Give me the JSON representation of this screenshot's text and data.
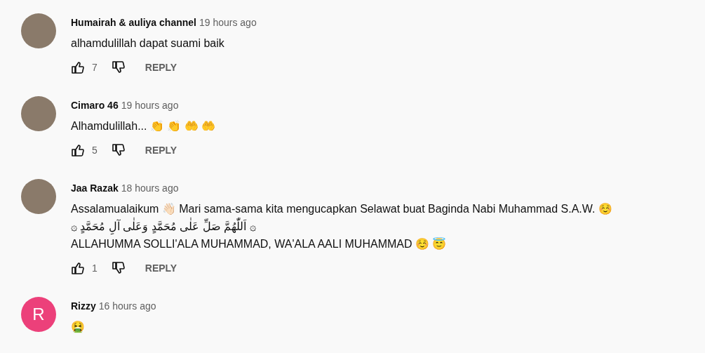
{
  "comments": [
    {
      "author": "Humairah & auliya channel",
      "time": "19 hours ago",
      "avatar": {
        "kind": "photo"
      },
      "lines": [
        "alhamdulillah dapat suami baik"
      ],
      "likes": "7",
      "reply": "REPLY"
    },
    {
      "author": "Cimaro 46",
      "time": "19 hours ago",
      "avatar": {
        "kind": "photo"
      },
      "lines": [
        "Alhamdulillah... 👏 👏 🤲 🤲"
      ],
      "likes": "5",
      "reply": "REPLY"
    },
    {
      "author": "Jaa Razak",
      "time": "18 hours ago",
      "avatar": {
        "kind": "photo"
      },
      "lines": [
        "Assalamualaikum 👋🏻  Mari sama-sama kita mengucapkan Selawat buat Baginda Nabi Muhammad S.A.W. ☺️",
        "۞ اَللّٰهُمَّ صَلِّ عَلٰى مُحَمَّدٍ وَعَلٰى آلِ مُحَمَّدٍ ۞",
        "ALLAHUMMA SOLLI'ALA MUHAMMAD, WA'ALA AALI MUHAMMAD ☺️ 😇"
      ],
      "likes": "1",
      "reply": "REPLY"
    },
    {
      "author": "Rizzy",
      "time": "16 hours ago",
      "avatar": {
        "kind": "letter",
        "letter": "R",
        "color": "#ec407a"
      },
      "lines": [
        "🤮"
      ]
    }
  ]
}
